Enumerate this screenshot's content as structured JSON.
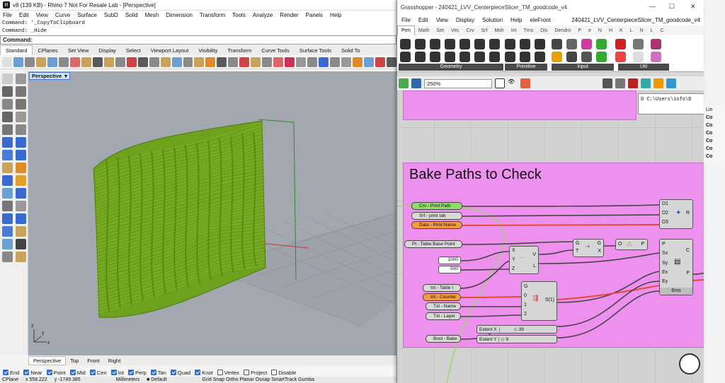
{
  "rhino": {
    "title": "v8 (139 KB) - Rhino 7 Not For Resale Lab - [Perspective]",
    "menu": [
      "File",
      "Edit",
      "View",
      "Curve",
      "Surface",
      "SubD",
      "Solid",
      "Mesh",
      "Dimension",
      "Transform",
      "Tools",
      "Analyze",
      "Render",
      "Panels",
      "Help"
    ],
    "command_history": [
      "Command: '_CopyToClipboard",
      "Command: _Hide"
    ],
    "command_prompt": "Command:",
    "tabs": [
      "Standard",
      "CPlanes",
      "Set View",
      "Display",
      "Select",
      "Viewport Layout",
      "Visibility",
      "Transform",
      "Curve Tools",
      "Surface Tools",
      "Solid To"
    ],
    "viewport_label": "Perspective",
    "viewport_tabs": [
      "Perspective",
      "Top",
      "Front",
      "Right"
    ],
    "osnaps": [
      {
        "label": "End",
        "on": true
      },
      {
        "label": "Near",
        "on": true
      },
      {
        "label": "Point",
        "on": true
      },
      {
        "label": "Mid",
        "on": true
      },
      {
        "label": "Cen",
        "on": true
      },
      {
        "label": "Int",
        "on": true
      },
      {
        "label": "Perp",
        "on": true
      },
      {
        "label": "Tan",
        "on": true
      },
      {
        "label": "Quad",
        "on": true
      },
      {
        "label": "Knot",
        "on": true
      },
      {
        "label": "Vertex",
        "on": false
      },
      {
        "label": "Project",
        "on": false
      },
      {
        "label": "Disable",
        "on": false
      }
    ],
    "status": {
      "cplane": "CPlane",
      "x": "x 558.222",
      "y": "y -1749.385",
      "units": "Millimeters",
      "layer": "Default",
      "toggles": "Grid Snap  Ortho  Planar  Osnap  SmartTrack  Gumba"
    }
  },
  "grasshopper": {
    "title": "Grasshopper - 240421_LVV_CenterpieceSlicer_TM_goodcode_v4",
    "doc_name": "240421_LVV_CenterpieceSlicer_TM_goodcode_v4",
    "menu": [
      "File",
      "Edit",
      "View",
      "Display",
      "Solution",
      "Help",
      "eleFront"
    ],
    "tabs": [
      "Prm",
      "Math",
      "Set",
      "Vec",
      "Crv",
      "Srf",
      "Msh",
      "Int",
      "Trns",
      "Dis",
      "Dendro",
      "P",
      "e",
      "N",
      "H",
      "K",
      "L",
      "N",
      "L",
      "C"
    ],
    "ribbon_groups": [
      "Geometry",
      "Primitive",
      "Input",
      "Util"
    ],
    "zoom": "250%",
    "panel_text": "0 C:\\Users\\info\\D",
    "group_title": "Bake Paths to Check",
    "params_left": [
      "Crv - Print Path",
      "Srf - print tab",
      "Data - Print Name",
      "Pt - Table Base Point",
      "Int - Table I",
      "Int - Counter",
      "Txt - Name",
      "Txt - Layer",
      "Bool - Bake"
    ],
    "numbers": [
      "1000",
      "500"
    ],
    "xyz_inputs": [
      "X",
      "Y",
      "Z"
    ],
    "xyz_outputs": [
      "V",
      "L"
    ],
    "bake_inputs": [
      "D1",
      "D2",
      "D3"
    ],
    "bake_output": "R",
    "move_inputs": [
      "G",
      "T"
    ],
    "move_outputs": [
      "G",
      "X"
    ],
    "orient_in": "O",
    "orient_out": "P",
    "rect_inputs": [
      "P",
      "Sx",
      "Sy",
      "Ex",
      "Ey"
    ],
    "rect_outputs": [
      "C",
      "P"
    ],
    "rect_time": "6ms",
    "stream_inputs": [
      "G",
      "0",
      "1",
      "2"
    ],
    "stream_output": "S(1)",
    "slider_x_label": "Extent X",
    "slider_x_value": "39",
    "slider_y_label": "Extent Y",
    "slider_y_value": "9",
    "side_items": [
      "Lin",
      "Co",
      "Co",
      "Co",
      "Co",
      "Co",
      "Co"
    ]
  }
}
